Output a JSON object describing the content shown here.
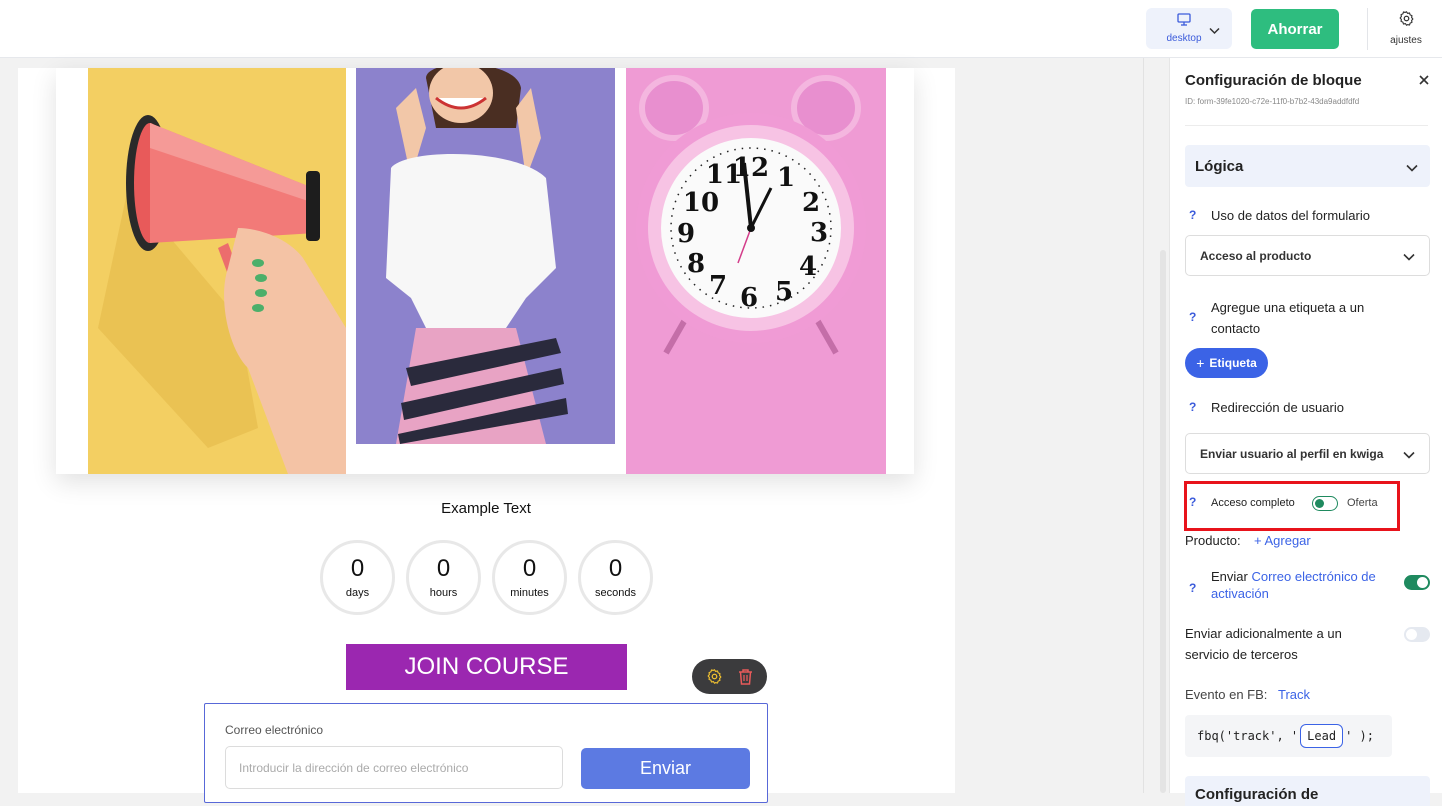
{
  "topbar": {
    "device_label": "desktop",
    "save_label": "Ahorrar",
    "settings_label": "ajustes"
  },
  "canvas": {
    "example_text": "Example Text",
    "timer": [
      {
        "value": "0",
        "unit": "days"
      },
      {
        "value": "0",
        "unit": "hours"
      },
      {
        "value": "0",
        "unit": "minutes"
      },
      {
        "value": "0",
        "unit": "seconds"
      }
    ],
    "join_label": "JOIN COURSE",
    "form": {
      "email_label": "Correo electrónico",
      "email_placeholder": "Introducir la dirección de correo electrónico",
      "send_label": "Enviar"
    }
  },
  "panel": {
    "title": "Configuración de bloque",
    "block_id": "ID: form-39fe1020-c72e-11f0-b7b2-43da9addfdfd",
    "logic_title": "Lógica",
    "form_data_label": "Uso de datos del formulario",
    "form_data_value": "Acceso al producto",
    "add_tag_label": "Agregue una etiqueta a un contacto",
    "tag_button": "Etiqueta",
    "redirect_label": "Redirección de usuario",
    "redirect_value": "Enviar usuario al perfil en kwiga",
    "full_access_label": "Acceso completo",
    "offer_label": "Oferta",
    "product_label": "Producto:",
    "add_link": "+ Agregar",
    "send_prefix": "Enviar",
    "send_link": "Correo electrónico de activación",
    "third_party_label": "Enviar adicionalmente a un servicio de terceros",
    "fb_event_label": "Evento en FB:",
    "fb_event_link": "Track",
    "code_prefix": "fbq('track', '",
    "code_value": "Lead",
    "code_suffix": "' );",
    "next_section_title": "Configuración de"
  },
  "colors": {
    "accent_green": "#2ebd7f",
    "toggle_green": "#1f8a5f",
    "link_blue": "#3b63e6",
    "join_purple": "#9b27b0",
    "send_blue": "#5c7ae2",
    "highlight_red": "#e8131b"
  },
  "icons": [
    "monitor-icon",
    "chevron-down-icon",
    "gear-icon",
    "close-icon",
    "plus-icon",
    "trash-icon",
    "help-icon"
  ]
}
